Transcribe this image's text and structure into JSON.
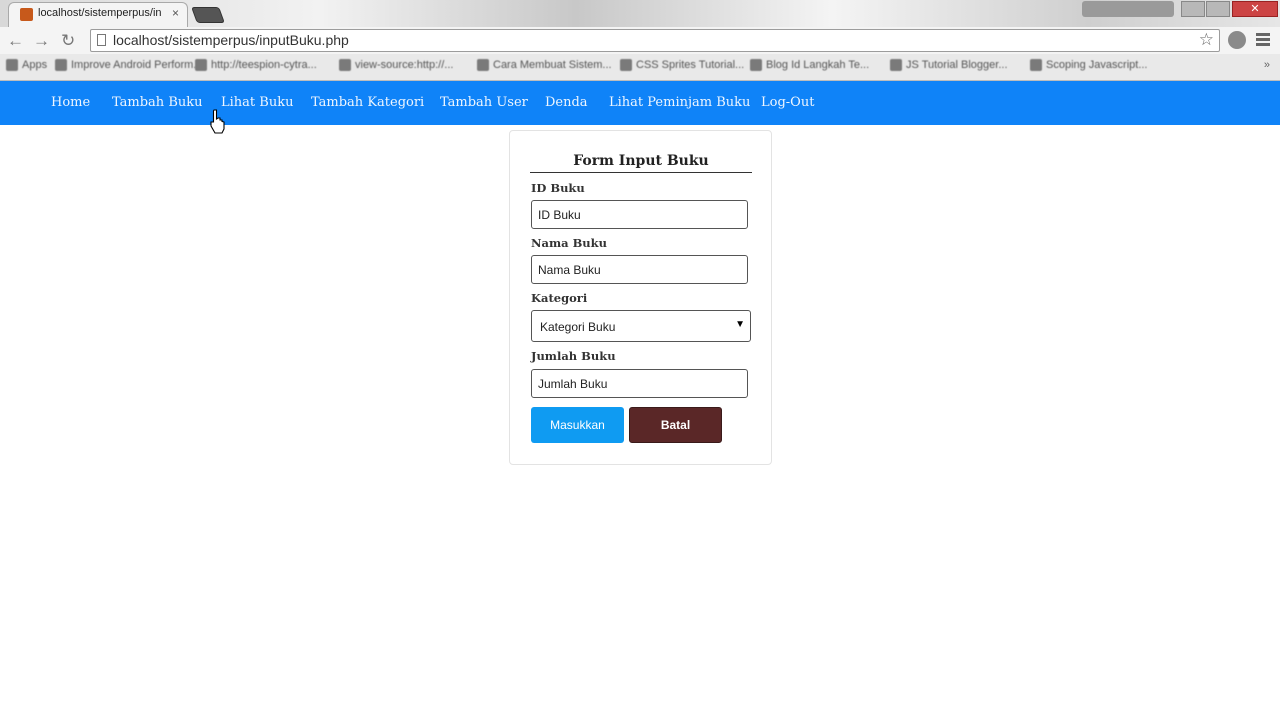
{
  "browser": {
    "tab_title": "localhost/sistemperpus/in",
    "tab_close": "×",
    "url": "localhost/sistemperpus/inputBuku.php",
    "close_glyph": "✕",
    "bookmarks": [
      "Apps",
      "Improve Android Perform...",
      "http://teespion-cytra...",
      "view-source:http://...",
      "Cara Membuat Sistem...",
      "CSS Sprites Tutorial...",
      "Blog Id Langkah Te...",
      "JS Tutorial Blogger...",
      "Scoping Javascript..."
    ],
    "bookmark_more": "»"
  },
  "nav": {
    "items": [
      "Home",
      "Tambah Buku",
      "Lihat Buku",
      "Tambah Kategori",
      "Tambah User",
      "Denda",
      "Lihat Peminjam Buku",
      "Log-Out"
    ]
  },
  "form": {
    "title": "Form Input Buku",
    "id_label": "ID Buku",
    "id_placeholder": "ID Buku",
    "name_label": "Nama Buku",
    "name_placeholder": "Nama Buku",
    "category_label": "Kategori",
    "category_selected": "Kategori Buku",
    "qty_label": "Jumlah Buku",
    "qty_placeholder": "Jumlah Buku",
    "submit_label": "Masukkan",
    "cancel_label": "Batal"
  },
  "colors": {
    "navbar": "#0f83f8",
    "submit_button": "#0f9bf2",
    "cancel_button": "#5a2727"
  }
}
